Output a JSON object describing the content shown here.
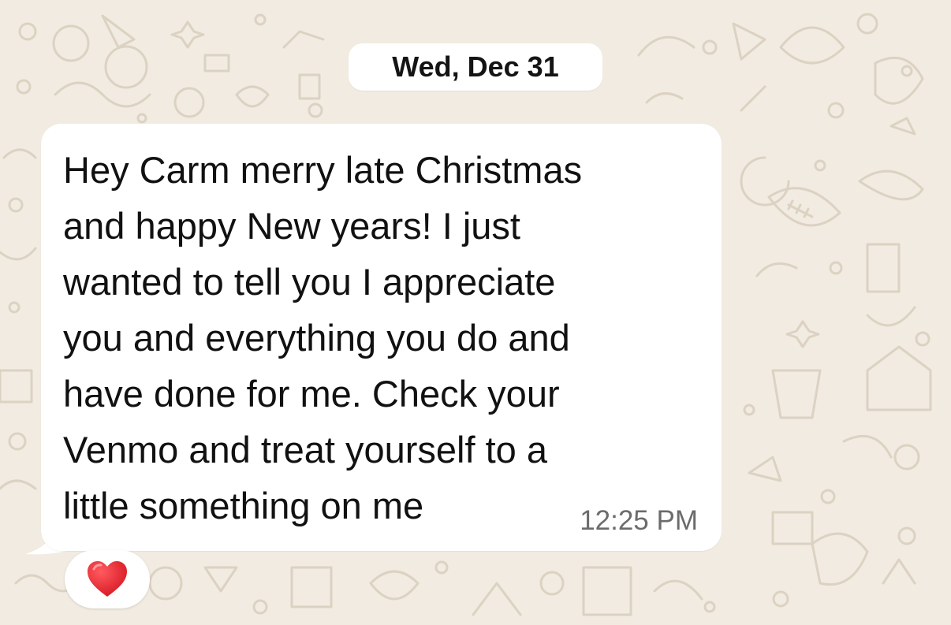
{
  "date_header": {
    "label": "Wed, Dec 31"
  },
  "message": {
    "text": "Hey Carm merry late Christmas\nand happy New years! I just\nwanted to tell you I appreciate\nyou and everything you do and\nhave done for me. Check your\nVenmo and treat yourself to a\nlittle something on me",
    "time": "12:25 PM",
    "direction": "incoming"
  },
  "reaction": {
    "icon": "heart-icon",
    "color": "#e0242e"
  },
  "colors": {
    "background": "#f1ebe1",
    "bubble": "#ffffff",
    "text": "#111111",
    "timestamp": "#6b6b6b",
    "doodle": "#dcd2c2"
  }
}
